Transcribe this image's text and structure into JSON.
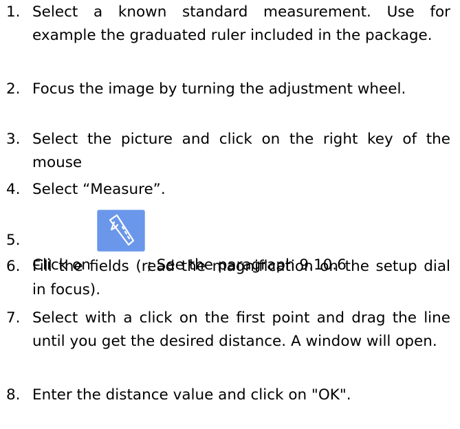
{
  "steps": [
    {
      "num": "1.",
      "text": "Select a known standard measurement. Use for example the graduated  ruler included in the package."
    },
    {
      "num": "2.",
      "text": "Focus the image by turning the adjustment wheel."
    },
    {
      "num": "3.",
      "text": "Select the picture and click on the right key of the mouse"
    },
    {
      "num": "4.",
      "text": "Select “Measure”."
    },
    {
      "num": "5.",
      "before": "Click on ",
      "icon": "caliper-icon",
      "after": "; See the paragraph 9.10.6"
    },
    {
      "num": "6.",
      "text": "Fill the fields (read the magnification on the setup dial in focus)."
    },
    {
      "num": "7.",
      "text": "Select with a click on the first point and drag the line until you get the desired distance. A window will open."
    },
    {
      "num": "8.",
      "text": "Enter the distance value and click on \"OK\"."
    }
  ]
}
